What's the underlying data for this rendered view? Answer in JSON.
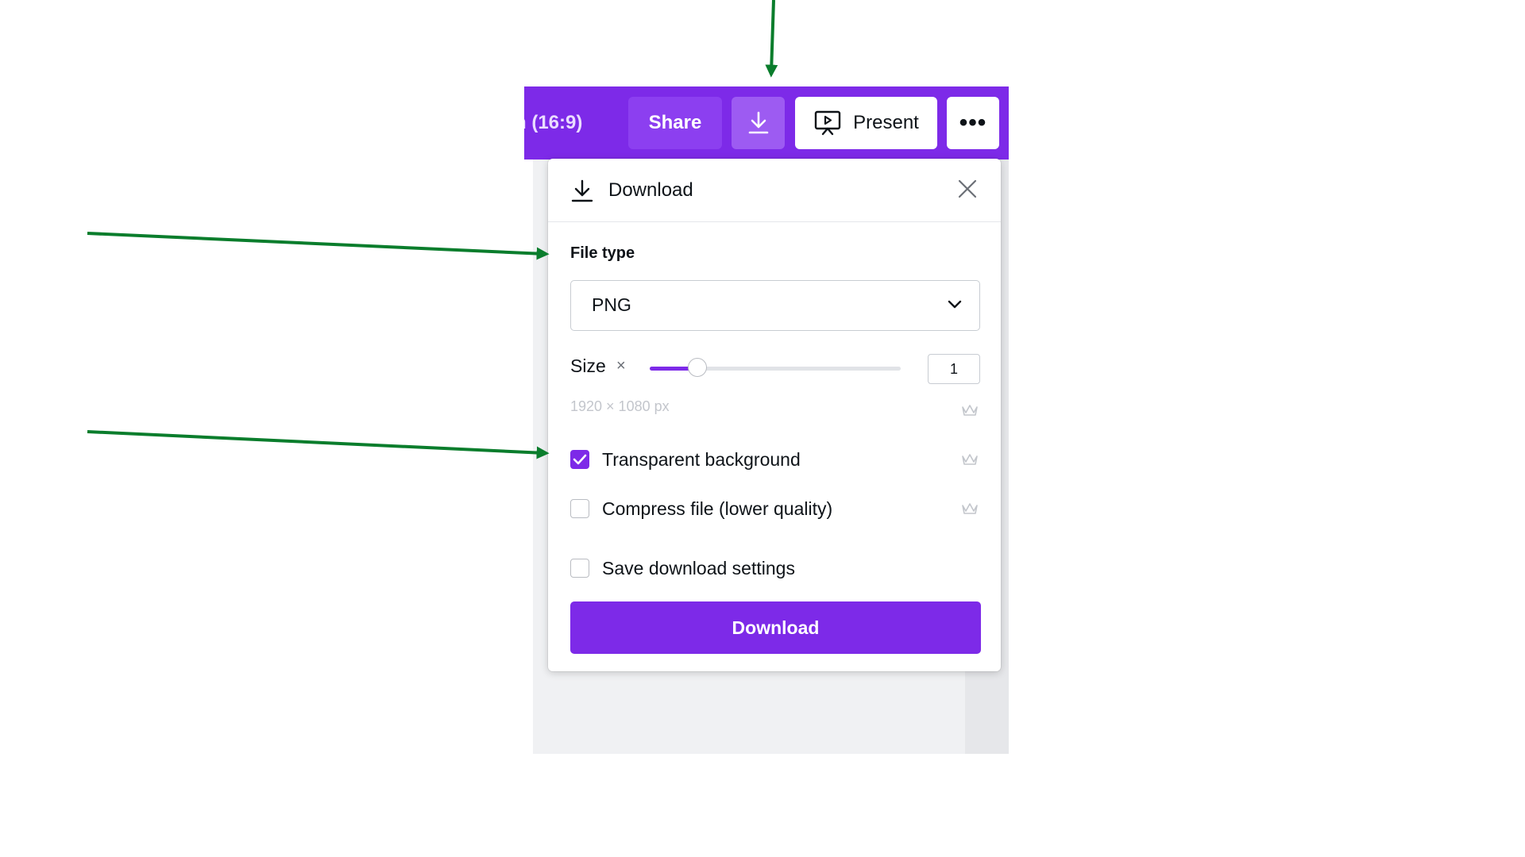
{
  "colors": {
    "brand_purple": "#7d2ae8",
    "annotation_green": "#0a7d2c",
    "panel_bg": "#ffffff",
    "canvas_bg": "#f0f1f3"
  },
  "toolbar": {
    "doc_title_fragment": "n (16:9)",
    "share_label": "Share",
    "download_icon": "download-icon",
    "present_label": "Present",
    "present_icon": "present-icon",
    "more_label": "•••"
  },
  "panel": {
    "title": "Download",
    "title_icon": "download-icon",
    "close_icon": "close-icon",
    "file_type_label": "File type",
    "file_type_value": "PNG",
    "size_label": "Size",
    "size_multiplier_symbol": "×",
    "size_value": "1",
    "size_slider_fraction": 0.19,
    "dimensions": "1920 × 1080 px",
    "options": [
      {
        "label": "Transparent background",
        "checked": true,
        "pro_crown": true
      },
      {
        "label": "Compress file (lower quality)",
        "checked": false,
        "pro_crown": true
      },
      {
        "label": "Save download settings",
        "checked": false,
        "pro_crown": false
      }
    ],
    "download_button": "Download"
  }
}
